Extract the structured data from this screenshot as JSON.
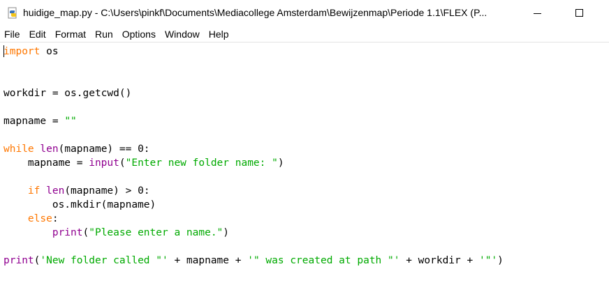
{
  "window": {
    "title": "huidige_map.py - C:\\Users\\pinkf\\Documents\\Mediacollege Amsterdam\\Bewijzenmap\\Periode 1.1\\FLEX (P..."
  },
  "menu": [
    "File",
    "Edit",
    "Format",
    "Run",
    "Options",
    "Window",
    "Help"
  ],
  "code": [
    [
      {
        "t": "import",
        "c": "kw"
      },
      {
        "t": " os",
        "c": ""
      }
    ],
    [],
    [],
    [
      {
        "t": "workdir = os.getcwd()",
        "c": ""
      }
    ],
    [],
    [
      {
        "t": "mapname = ",
        "c": ""
      },
      {
        "t": "\"\"",
        "c": "st"
      }
    ],
    [],
    [
      {
        "t": "while",
        "c": "kw"
      },
      {
        "t": " ",
        "c": ""
      },
      {
        "t": "len",
        "c": "bi"
      },
      {
        "t": "(mapname) == 0:",
        "c": ""
      }
    ],
    [
      {
        "t": "    mapname = ",
        "c": ""
      },
      {
        "t": "input",
        "c": "bi"
      },
      {
        "t": "(",
        "c": ""
      },
      {
        "t": "\"Enter new folder name: \"",
        "c": "st"
      },
      {
        "t": ")",
        "c": ""
      }
    ],
    [],
    [
      {
        "t": "    ",
        "c": ""
      },
      {
        "t": "if",
        "c": "kw"
      },
      {
        "t": " ",
        "c": ""
      },
      {
        "t": "len",
        "c": "bi"
      },
      {
        "t": "(mapname) > 0:",
        "c": ""
      }
    ],
    [
      {
        "t": "        os.mkdir(mapname)",
        "c": ""
      }
    ],
    [
      {
        "t": "    ",
        "c": ""
      },
      {
        "t": "else",
        "c": "kw"
      },
      {
        "t": ":",
        "c": ""
      }
    ],
    [
      {
        "t": "        ",
        "c": ""
      },
      {
        "t": "print",
        "c": "bi"
      },
      {
        "t": "(",
        "c": ""
      },
      {
        "t": "\"Please enter a name.\"",
        "c": "st"
      },
      {
        "t": ")",
        "c": ""
      }
    ],
    [],
    [
      {
        "t": "print",
        "c": "bi"
      },
      {
        "t": "(",
        "c": ""
      },
      {
        "t": "'New folder called \"'",
        "c": "st"
      },
      {
        "t": " + mapname + ",
        "c": ""
      },
      {
        "t": "'\" was created at path \"'",
        "c": "st"
      },
      {
        "t": " + workdir + ",
        "c": ""
      },
      {
        "t": "'\"'",
        "c": "st"
      },
      {
        "t": ")",
        "c": ""
      }
    ]
  ]
}
